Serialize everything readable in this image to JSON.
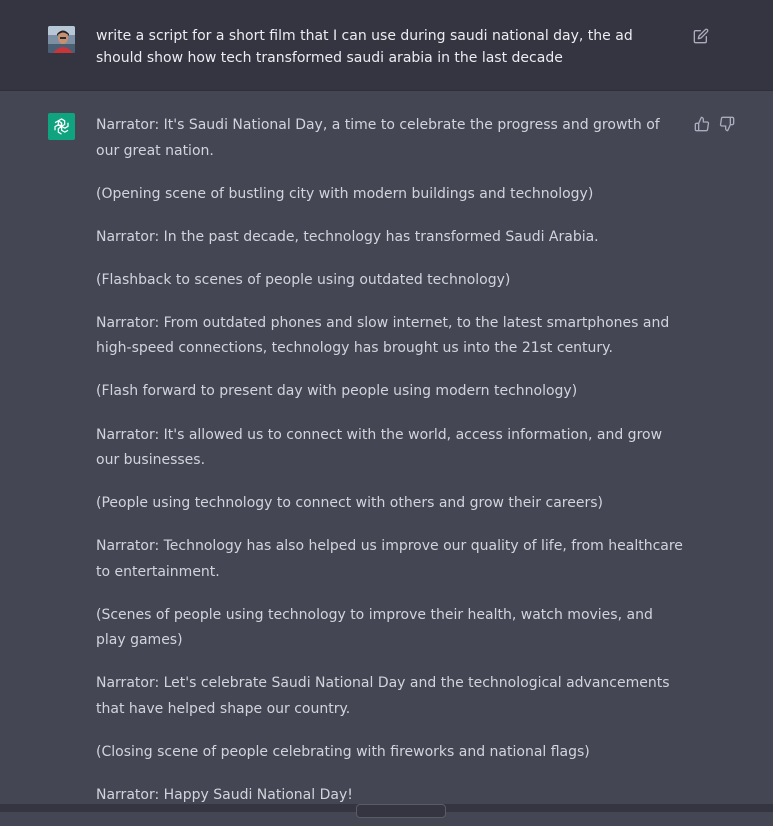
{
  "user_message": {
    "text": "write a script for a short film that I can use during saudi national day, the ad should show how tech transformed saudi arabia in the last decade",
    "avatar_icon": "user-photo-avatar",
    "edit_icon": "edit-icon"
  },
  "assistant_message": {
    "avatar_icon": "openai-logo-icon",
    "accent_color": "#10a37f",
    "feedback": {
      "up_icon": "thumbs-up-icon",
      "down_icon": "thumbs-down-icon"
    },
    "paragraphs": [
      "Narrator: It's Saudi National Day, a time to celebrate the progress and growth of our great nation.",
      "(Opening scene of bustling city with modern buildings and technology)",
      "Narrator: In the past decade, technology has transformed Saudi Arabia.",
      "(Flashback to scenes of people using outdated technology)",
      "Narrator: From outdated phones and slow internet, to the latest smartphones and high-speed connections, technology has brought us into the 21st century.",
      "(Flash forward to present day with people using modern technology)",
      "Narrator: It's allowed us to connect with the world, access information, and grow our businesses.",
      "(People using technology to connect with others and grow their careers)",
      "Narrator: Technology has also helped us improve our quality of life, from healthcare to entertainment.",
      "(Scenes of people using technology to improve their health, watch movies, and play games)",
      "Narrator: Let's celebrate Saudi National Day and the technological advancements that have helped shape our country.",
      "(Closing scene of people celebrating with fireworks and national flags)",
      "Narrator: Happy Saudi National Day!"
    ]
  }
}
